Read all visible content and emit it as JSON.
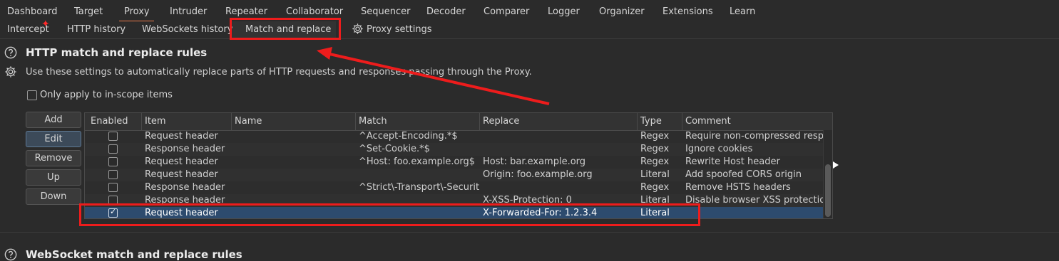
{
  "top_tabs": [
    "Dashboard",
    "Target",
    "Proxy",
    "Intruder",
    "Repeater",
    "Collaborator",
    "Sequencer",
    "Decoder",
    "Comparer",
    "Logger",
    "Organizer",
    "Extensions",
    "Learn"
  ],
  "active_top_tab": "Proxy",
  "sub_tabs": {
    "intercept": "Intercept",
    "http_history": "HTTP history",
    "websockets_history": "WebSockets history",
    "match_replace": "Match and replace",
    "proxy_settings": "Proxy settings"
  },
  "intercept_marker": "✦",
  "http_section": {
    "title": "HTTP match and replace rules",
    "description": "Use these settings to automatically replace parts of HTTP requests and responses passing through the Proxy.",
    "scope_label": "Only apply to in-scope items",
    "scope_checked": false
  },
  "buttons": {
    "add": "Add",
    "edit": "Edit",
    "remove": "Remove",
    "up": "Up",
    "down": "Down"
  },
  "table": {
    "columns": {
      "enabled": "Enabled",
      "item": "Item",
      "name": "Name",
      "match": "Match",
      "replace": "Replace",
      "type": "Type",
      "comment": "Comment"
    },
    "rows": [
      {
        "enabled": false,
        "item": "Request header",
        "name": "",
        "match": "^Accept-Encoding.*$",
        "replace": "",
        "type": "Regex",
        "comment": "Require non-compressed respo..."
      },
      {
        "enabled": false,
        "item": "Response header",
        "name": "",
        "match": "^Set-Cookie.*$",
        "replace": "",
        "type": "Regex",
        "comment": "Ignore cookies"
      },
      {
        "enabled": false,
        "item": "Request header",
        "name": "",
        "match": "^Host: foo.example.org$",
        "replace": "Host: bar.example.org",
        "type": "Regex",
        "comment": "Rewrite Host header"
      },
      {
        "enabled": false,
        "item": "Request header",
        "name": "",
        "match": "",
        "replace": "Origin: foo.example.org",
        "type": "Literal",
        "comment": "Add spoofed CORS origin"
      },
      {
        "enabled": false,
        "item": "Response header",
        "name": "",
        "match": "^Strict\\-Transport\\-Securit...",
        "replace": "",
        "type": "Regex",
        "comment": "Remove HSTS headers"
      },
      {
        "enabled": false,
        "item": "Response header",
        "name": "",
        "match": "",
        "replace": "X-XSS-Protection: 0",
        "type": "Literal",
        "comment": "Disable browser XSS protection"
      },
      {
        "enabled": true,
        "item": "Request header",
        "name": "",
        "match": "",
        "replace": "X-Forwarded-For: 1.2.3.4",
        "type": "Literal",
        "comment": ""
      }
    ],
    "selected_row": 6
  },
  "websocket_section": {
    "title": "WebSocket match and replace rules"
  },
  "colors": {
    "background": "#2b2b2b",
    "accent_tab_underline": "#e8794a",
    "selected_row": "#2d4b6e",
    "annotation_red": "#ee1c1c"
  }
}
